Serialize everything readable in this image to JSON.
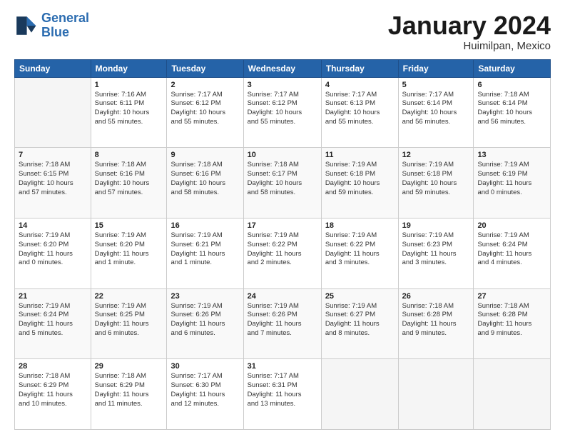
{
  "logo": {
    "line1": "General",
    "line2": "Blue"
  },
  "title": "January 2024",
  "subtitle": "Huimilpan, Mexico",
  "days_header": [
    "Sunday",
    "Monday",
    "Tuesday",
    "Wednesday",
    "Thursday",
    "Friday",
    "Saturday"
  ],
  "weeks": [
    [
      {
        "day": "",
        "info": ""
      },
      {
        "day": "1",
        "info": "Sunrise: 7:16 AM\nSunset: 6:11 PM\nDaylight: 10 hours\nand 55 minutes."
      },
      {
        "day": "2",
        "info": "Sunrise: 7:17 AM\nSunset: 6:12 PM\nDaylight: 10 hours\nand 55 minutes."
      },
      {
        "day": "3",
        "info": "Sunrise: 7:17 AM\nSunset: 6:12 PM\nDaylight: 10 hours\nand 55 minutes."
      },
      {
        "day": "4",
        "info": "Sunrise: 7:17 AM\nSunset: 6:13 PM\nDaylight: 10 hours\nand 55 minutes."
      },
      {
        "day": "5",
        "info": "Sunrise: 7:17 AM\nSunset: 6:14 PM\nDaylight: 10 hours\nand 56 minutes."
      },
      {
        "day": "6",
        "info": "Sunrise: 7:18 AM\nSunset: 6:14 PM\nDaylight: 10 hours\nand 56 minutes."
      }
    ],
    [
      {
        "day": "7",
        "info": "Sunrise: 7:18 AM\nSunset: 6:15 PM\nDaylight: 10 hours\nand 57 minutes."
      },
      {
        "day": "8",
        "info": "Sunrise: 7:18 AM\nSunset: 6:16 PM\nDaylight: 10 hours\nand 57 minutes."
      },
      {
        "day": "9",
        "info": "Sunrise: 7:18 AM\nSunset: 6:16 PM\nDaylight: 10 hours\nand 58 minutes."
      },
      {
        "day": "10",
        "info": "Sunrise: 7:18 AM\nSunset: 6:17 PM\nDaylight: 10 hours\nand 58 minutes."
      },
      {
        "day": "11",
        "info": "Sunrise: 7:19 AM\nSunset: 6:18 PM\nDaylight: 10 hours\nand 59 minutes."
      },
      {
        "day": "12",
        "info": "Sunrise: 7:19 AM\nSunset: 6:18 PM\nDaylight: 10 hours\nand 59 minutes."
      },
      {
        "day": "13",
        "info": "Sunrise: 7:19 AM\nSunset: 6:19 PM\nDaylight: 11 hours\nand 0 minutes."
      }
    ],
    [
      {
        "day": "14",
        "info": "Sunrise: 7:19 AM\nSunset: 6:20 PM\nDaylight: 11 hours\nand 0 minutes."
      },
      {
        "day": "15",
        "info": "Sunrise: 7:19 AM\nSunset: 6:20 PM\nDaylight: 11 hours\nand 1 minute."
      },
      {
        "day": "16",
        "info": "Sunrise: 7:19 AM\nSunset: 6:21 PM\nDaylight: 11 hours\nand 1 minute."
      },
      {
        "day": "17",
        "info": "Sunrise: 7:19 AM\nSunset: 6:22 PM\nDaylight: 11 hours\nand 2 minutes."
      },
      {
        "day": "18",
        "info": "Sunrise: 7:19 AM\nSunset: 6:22 PM\nDaylight: 11 hours\nand 3 minutes."
      },
      {
        "day": "19",
        "info": "Sunrise: 7:19 AM\nSunset: 6:23 PM\nDaylight: 11 hours\nand 3 minutes."
      },
      {
        "day": "20",
        "info": "Sunrise: 7:19 AM\nSunset: 6:24 PM\nDaylight: 11 hours\nand 4 minutes."
      }
    ],
    [
      {
        "day": "21",
        "info": "Sunrise: 7:19 AM\nSunset: 6:24 PM\nDaylight: 11 hours\nand 5 minutes."
      },
      {
        "day": "22",
        "info": "Sunrise: 7:19 AM\nSunset: 6:25 PM\nDaylight: 11 hours\nand 6 minutes."
      },
      {
        "day": "23",
        "info": "Sunrise: 7:19 AM\nSunset: 6:26 PM\nDaylight: 11 hours\nand 6 minutes."
      },
      {
        "day": "24",
        "info": "Sunrise: 7:19 AM\nSunset: 6:26 PM\nDaylight: 11 hours\nand 7 minutes."
      },
      {
        "day": "25",
        "info": "Sunrise: 7:19 AM\nSunset: 6:27 PM\nDaylight: 11 hours\nand 8 minutes."
      },
      {
        "day": "26",
        "info": "Sunrise: 7:18 AM\nSunset: 6:28 PM\nDaylight: 11 hours\nand 9 minutes."
      },
      {
        "day": "27",
        "info": "Sunrise: 7:18 AM\nSunset: 6:28 PM\nDaylight: 11 hours\nand 9 minutes."
      }
    ],
    [
      {
        "day": "28",
        "info": "Sunrise: 7:18 AM\nSunset: 6:29 PM\nDaylight: 11 hours\nand 10 minutes."
      },
      {
        "day": "29",
        "info": "Sunrise: 7:18 AM\nSunset: 6:29 PM\nDaylight: 11 hours\nand 11 minutes."
      },
      {
        "day": "30",
        "info": "Sunrise: 7:17 AM\nSunset: 6:30 PM\nDaylight: 11 hours\nand 12 minutes."
      },
      {
        "day": "31",
        "info": "Sunrise: 7:17 AM\nSunset: 6:31 PM\nDaylight: 11 hours\nand 13 minutes."
      },
      {
        "day": "",
        "info": ""
      },
      {
        "day": "",
        "info": ""
      },
      {
        "day": "",
        "info": ""
      }
    ]
  ]
}
